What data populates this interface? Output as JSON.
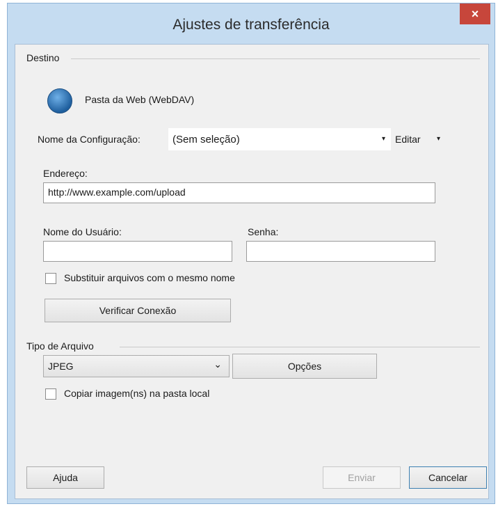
{
  "window": {
    "title": "Ajustes de transferência",
    "close_glyph": "×"
  },
  "destination": {
    "group_label": "Destino",
    "service_icon": "globe-icon",
    "service_name": "Pasta da Web (WebDAV)",
    "config_label": "Nome da Configuração:",
    "config_value": "(Sem seleção)",
    "config_arrow": "▾",
    "edit_label": "Editar",
    "edit_arrow": "▾",
    "address_label": "Endereço:",
    "address_value": "http://www.example.com/upload",
    "username_label": "Nome do Usuário:",
    "username_value": "",
    "password_label": "Senha:",
    "password_value": "",
    "overwrite_label": "Substituir arquivos com o mesmo nome",
    "overwrite_checked": false,
    "verify_button": "Verificar Conexão"
  },
  "file_type": {
    "group_label": "Tipo de Arquivo",
    "selected": "JPEG",
    "dropdown_arrow": "⌄",
    "options_button": "Opções",
    "copy_local_label": "Copiar imagem(ns) na pasta local",
    "copy_local_checked": false
  },
  "footer": {
    "help_button": "Ajuda",
    "send_button": "Enviar",
    "cancel_button": "Cancelar"
  },
  "colors": {
    "title_bar": "#c5dcf1",
    "close_button": "#c7463b",
    "dialog_background": "#f0f0f0"
  }
}
